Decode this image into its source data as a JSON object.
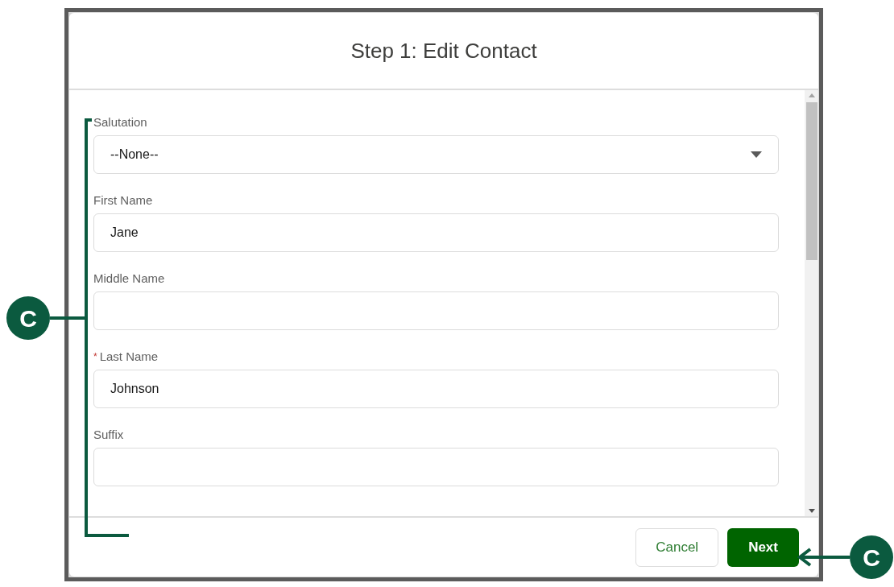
{
  "dialog": {
    "title": "Step 1: Edit Contact"
  },
  "fields": [
    {
      "label": "Salutation",
      "kind": "select",
      "value": "--None--"
    },
    {
      "label": "First Name",
      "kind": "text",
      "value": "Jane"
    },
    {
      "label": "Middle Name",
      "kind": "text"
    },
    {
      "label": "Last Name",
      "kind": "text",
      "value": "Johnson",
      "required_mark": "*"
    },
    {
      "label": "Suffix",
      "kind": "text"
    }
  ],
  "buttons": [
    {
      "label": "Cancel",
      "kind": "neutral"
    },
    {
      "label": "Next",
      "kind": "brand"
    }
  ],
  "form_callout": {
    "label": "C"
  },
  "button_callout": {
    "label": "C"
  }
}
